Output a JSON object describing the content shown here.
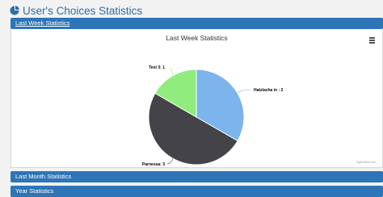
{
  "page": {
    "title": "User's Choices Statistics",
    "icon": "pie-chart-icon"
  },
  "panels": [
    {
      "label": "Last Week Statistics",
      "active": true
    },
    {
      "label": "Last Month Statistics",
      "active": false
    },
    {
      "label": "Year Statistics",
      "active": false
    }
  ],
  "chart_data": {
    "type": "pie",
    "title": "Last Week Statistics",
    "slices": [
      {
        "name": "Hatzlacha in",
        "value": 2,
        "color": "#7cb5ec"
      },
      {
        "name": "Parnessa",
        "value": 3,
        "color": "#434348"
      },
      {
        "name": "Test 3",
        "value": 1,
        "color": "#90ed7d"
      }
    ],
    "labels": [
      "Hatzlacha in : 2",
      "Parnessa: 3",
      "Test 3: 1"
    ],
    "credits": "Highcharts.com"
  },
  "colors": {
    "header": "#2d75b6",
    "title": "#2f6ea5"
  }
}
